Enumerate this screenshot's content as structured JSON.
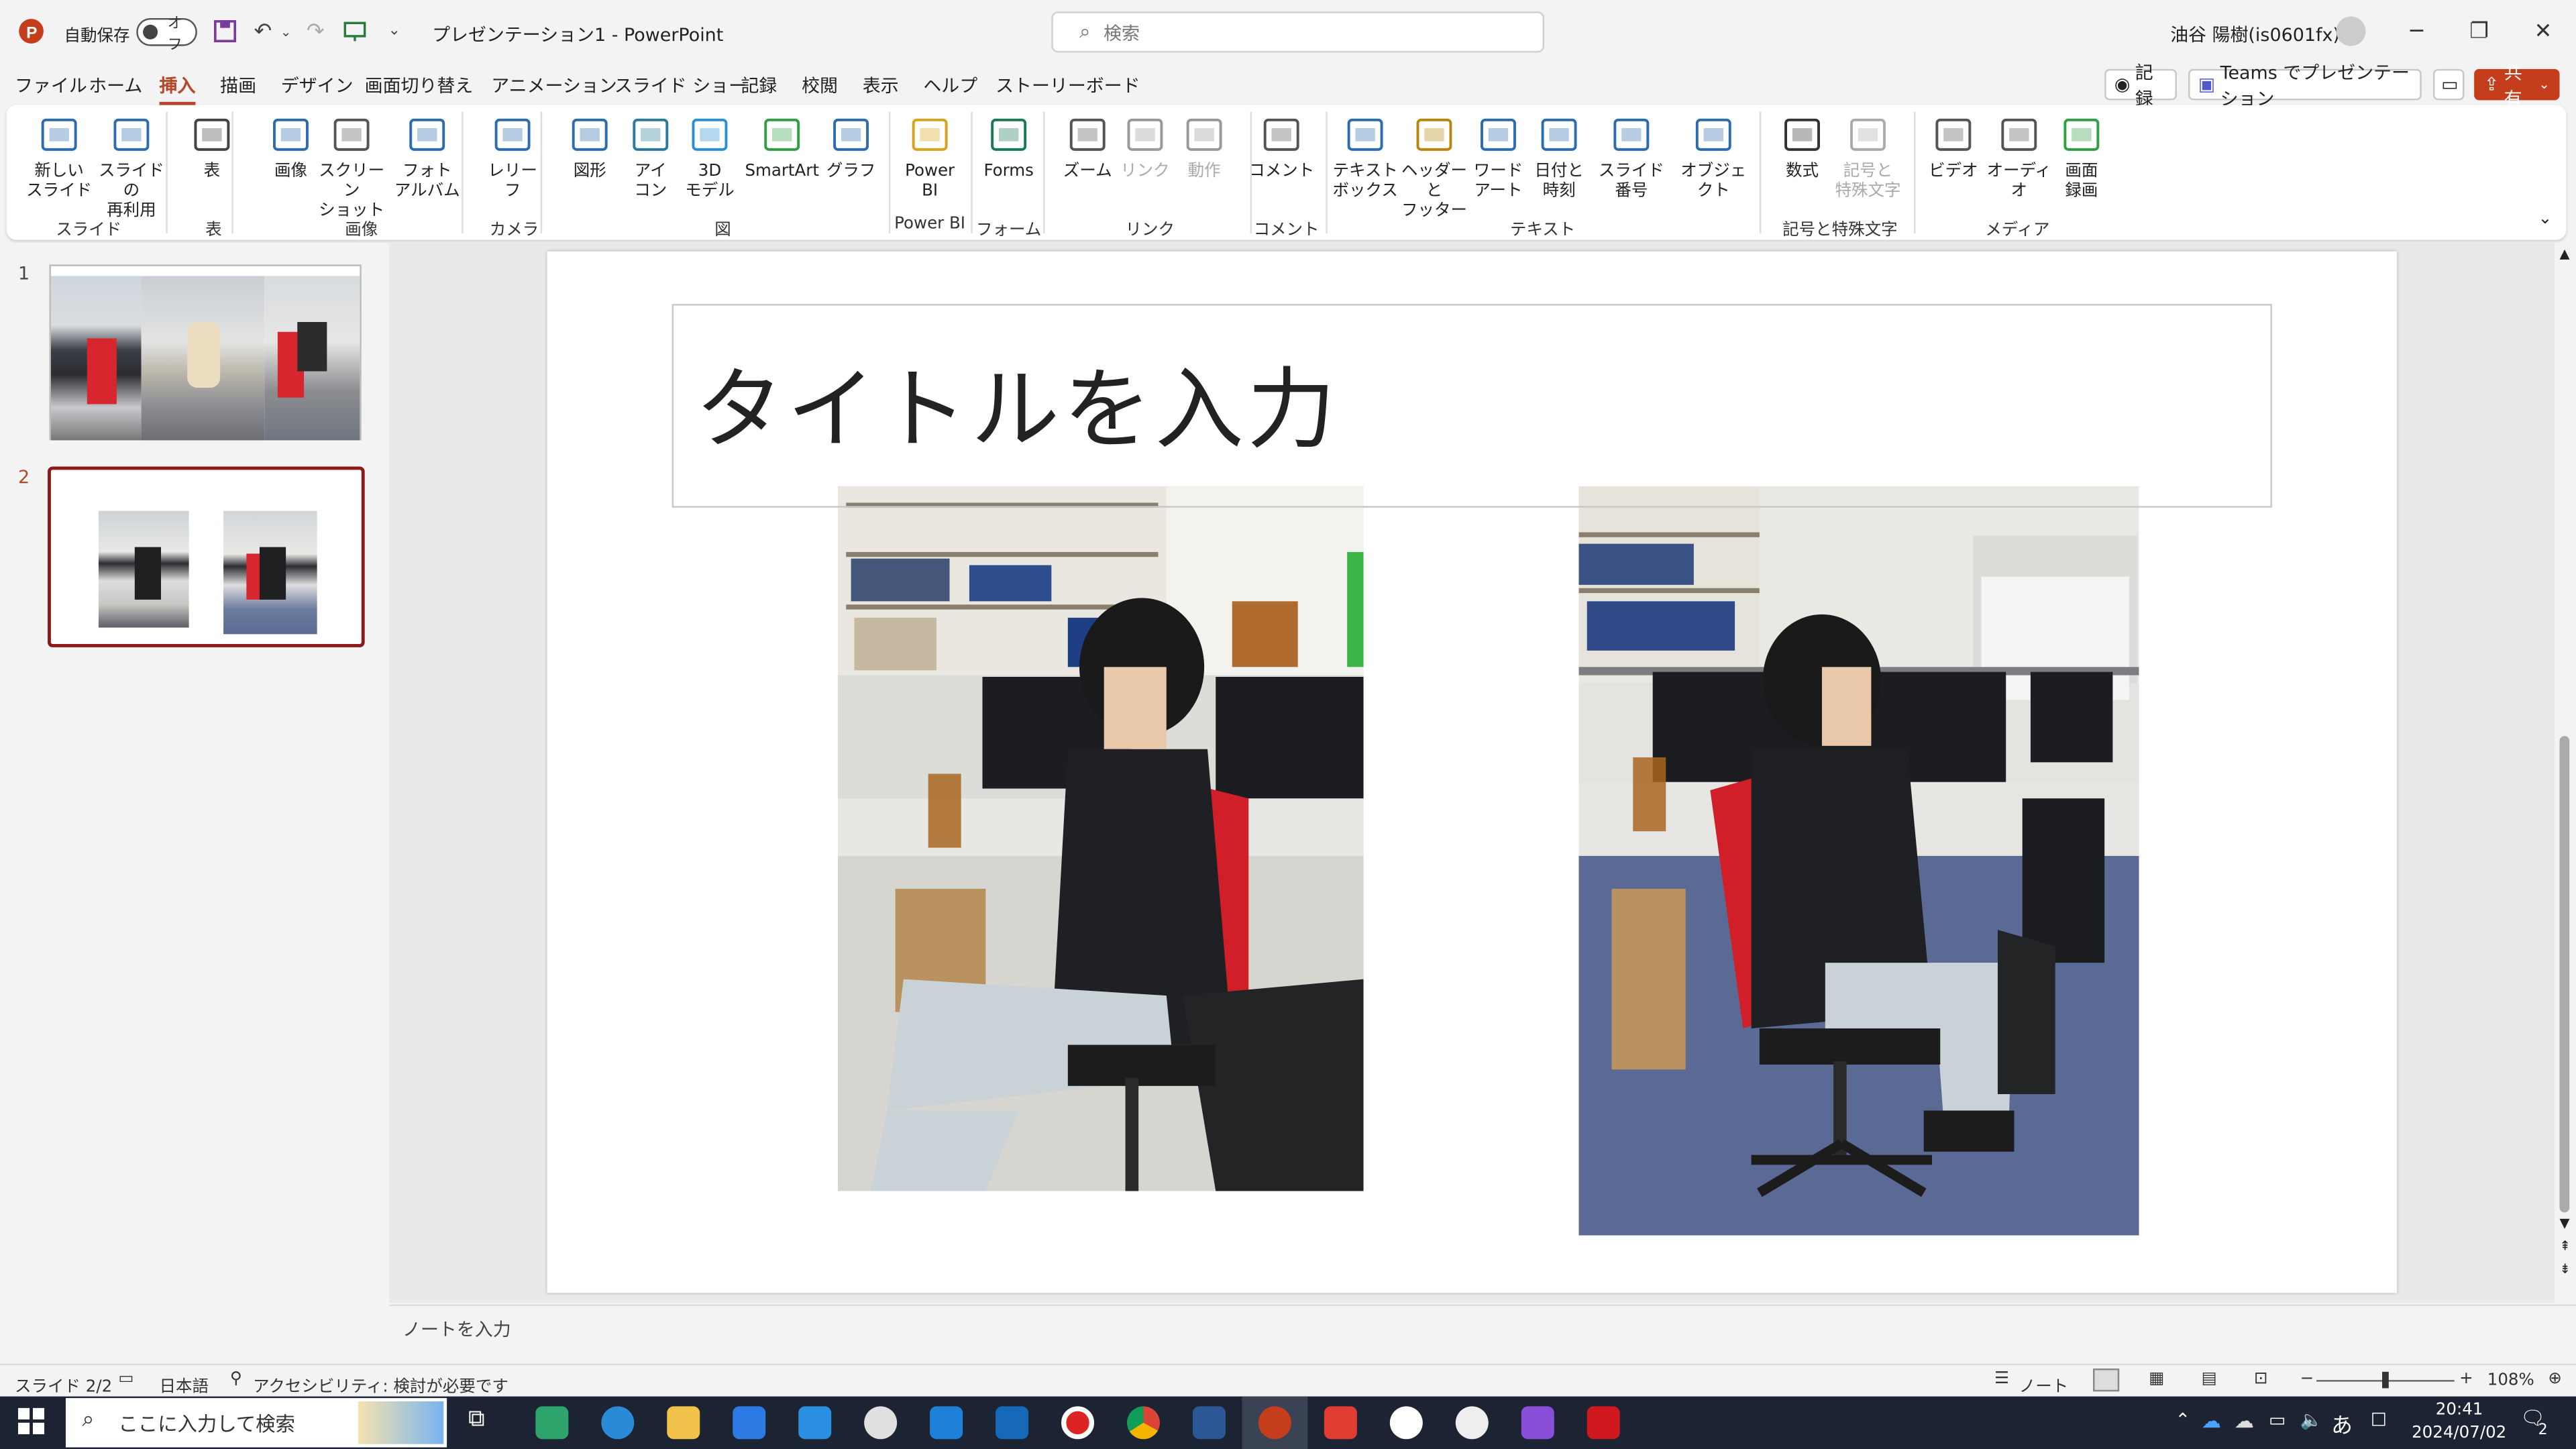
{
  "window": {
    "app_name": "PowerPoint",
    "doc_title": "プレゼンテーション1  -  PowerPoint",
    "autosave_label": "自動保存",
    "autosave_state": "オフ",
    "user": "油谷 陽樹(is0601fx)"
  },
  "search": {
    "placeholder": "検索"
  },
  "menu": {
    "tabs": [
      "ファイル",
      "ホーム",
      "挿入",
      "描画",
      "デザイン",
      "画面切り替え",
      "アニメーション",
      "スライド ショー",
      "記録",
      "校閲",
      "表示",
      "ヘルプ",
      "ストーリーボード"
    ],
    "active": "挿入",
    "record_btn": "記録",
    "teams_btn": "Teams でプレゼンテーション",
    "share_btn": "共有"
  },
  "ribbon": {
    "buttons": [
      {
        "label": "新しい\nスライド",
        "icon": "new-slide-icon"
      },
      {
        "label": "スライドの\n再利用",
        "icon": "reuse-slides-icon"
      },
      {
        "label": "表",
        "icon": "table-icon"
      },
      {
        "label": "画像",
        "icon": "picture-icon"
      },
      {
        "label": "スクリーン\nショット",
        "icon": "screenshot-icon"
      },
      {
        "label": "フォト\nアルバム",
        "icon": "photo-album-icon"
      },
      {
        "label": "レリー\nフ",
        "icon": "cameo-icon"
      },
      {
        "label": "図形",
        "icon": "shapes-icon"
      },
      {
        "label": "アイ\nコン",
        "icon": "icons-icon"
      },
      {
        "label": "3D\nモデル",
        "icon": "3d-model-icon"
      },
      {
        "label": "SmartArt",
        "icon": "smartart-icon"
      },
      {
        "label": "グラフ",
        "icon": "chart-icon"
      },
      {
        "label": "Power\nBI",
        "icon": "power-bi-icon"
      },
      {
        "label": "Forms",
        "icon": "forms-icon"
      },
      {
        "label": "ズーム",
        "icon": "zoom-icon"
      },
      {
        "label": "リンク",
        "icon": "link-icon"
      },
      {
        "label": "動作",
        "icon": "action-icon"
      },
      {
        "label": "コメント",
        "icon": "comment-icon"
      },
      {
        "label": "テキスト\nボックス",
        "icon": "textbox-icon"
      },
      {
        "label": "ヘッダーと\nフッター",
        "icon": "header-footer-icon"
      },
      {
        "label": "ワード\nアート",
        "icon": "wordart-icon"
      },
      {
        "label": "日付と\n時刻",
        "icon": "date-time-icon"
      },
      {
        "label": "スライド番号",
        "icon": "slide-number-icon"
      },
      {
        "label": "オブジェクト",
        "icon": "object-icon"
      },
      {
        "label": "数式",
        "icon": "equation-icon"
      },
      {
        "label": "記号と\n特殊文字",
        "icon": "symbol-icon"
      },
      {
        "label": "ビデオ",
        "icon": "video-icon"
      },
      {
        "label": "オーディオ",
        "icon": "audio-icon"
      },
      {
        "label": "画面\n録画",
        "icon": "screen-recording-icon"
      }
    ],
    "groups": [
      "スライド",
      "表",
      "画像",
      "カメラ",
      "図",
      "Power BI",
      "フォーム",
      "リンク",
      "コメント",
      "テキスト",
      "記号と特殊文字",
      "メディア"
    ]
  },
  "slides": {
    "numbers": [
      "1",
      "2"
    ],
    "selected": "2"
  },
  "slide": {
    "title_placeholder": "タイトルを入力"
  },
  "notes": {
    "placeholder": "ノートを入力"
  },
  "status": {
    "slide_pos": "スライド 2/2",
    "language": "日本語",
    "accessibility": "アクセシビリティ: 検討が必要です",
    "notes_btn": "ノート",
    "zoom": "108%"
  },
  "taskbar": {
    "search_placeholder": "ここに入力して検索",
    "time": "20:41",
    "date": "2024/07/02",
    "ime": "あ",
    "notifications": "2"
  },
  "colors": {
    "accent": "#b7472a",
    "taskbar": "#1c2433"
  }
}
